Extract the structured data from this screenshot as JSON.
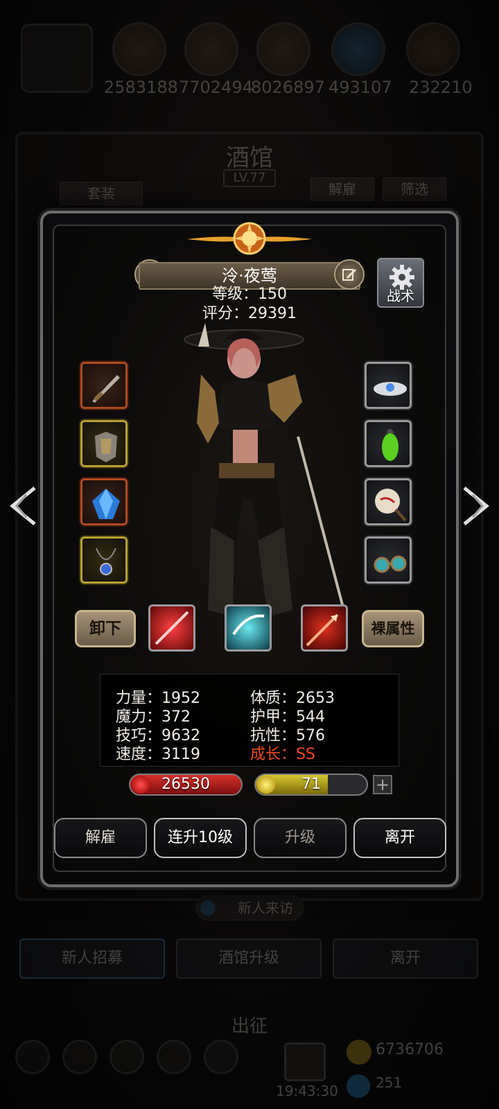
{
  "top_resources": {
    "values": [
      "2583188",
      "7702494",
      "8026897",
      "493107",
      "232210"
    ]
  },
  "tavern": {
    "title": "酒馆",
    "level": "LV.77",
    "set_button": "套装",
    "dismiss_button": "解雇",
    "filter_button": "筛选",
    "visitor_label": "新人来访",
    "recruit_button": "新人招募",
    "upgrade_button": "酒馆升级",
    "leave_button": "离开"
  },
  "bottom_bar": {
    "expedition_label": "出征",
    "gold": "6736706",
    "gems": "251",
    "time": "19:43:30"
  },
  "hero": {
    "name": "泠·夜莺",
    "level_line": "等级：150",
    "score_line": "评分：29391",
    "tactics_label": "战术"
  },
  "equipment": {
    "left": [
      {
        "name": "weapon-slot",
        "rarity": "red"
      },
      {
        "name": "armor-slot",
        "rarity": "gold"
      },
      {
        "name": "gem-slot",
        "rarity": "red"
      },
      {
        "name": "amulet-slot",
        "rarity": "gold"
      }
    ],
    "right": [
      {
        "name": "ring-slot",
        "rarity": "grey"
      },
      {
        "name": "charm-slot",
        "rarity": "grey"
      },
      {
        "name": "fan-slot",
        "rarity": "grey"
      },
      {
        "name": "goggles-slot",
        "rarity": "grey"
      }
    ]
  },
  "actions": {
    "unequip": "卸下",
    "base_attributes": "裸属性",
    "dismiss": "解雇",
    "level_up_10": "连升10级",
    "level_up": "升级",
    "leave": "离开"
  },
  "stats": {
    "strength": "力量：1952",
    "constitution": "体质：2653",
    "magic": "魔力：372",
    "armor": "护甲：544",
    "skill": "技巧：9632",
    "resistance": "抗性：576",
    "speed": "速度：3119",
    "growth": "成长：SS"
  },
  "vitals": {
    "hp": "26530",
    "energy": "71",
    "energy_fraction": 0.65,
    "plus": "+"
  },
  "colors": {
    "growth_text": "#f04a1a",
    "hp_bar": "#d8302c",
    "energy_bar": "#d8c830"
  }
}
